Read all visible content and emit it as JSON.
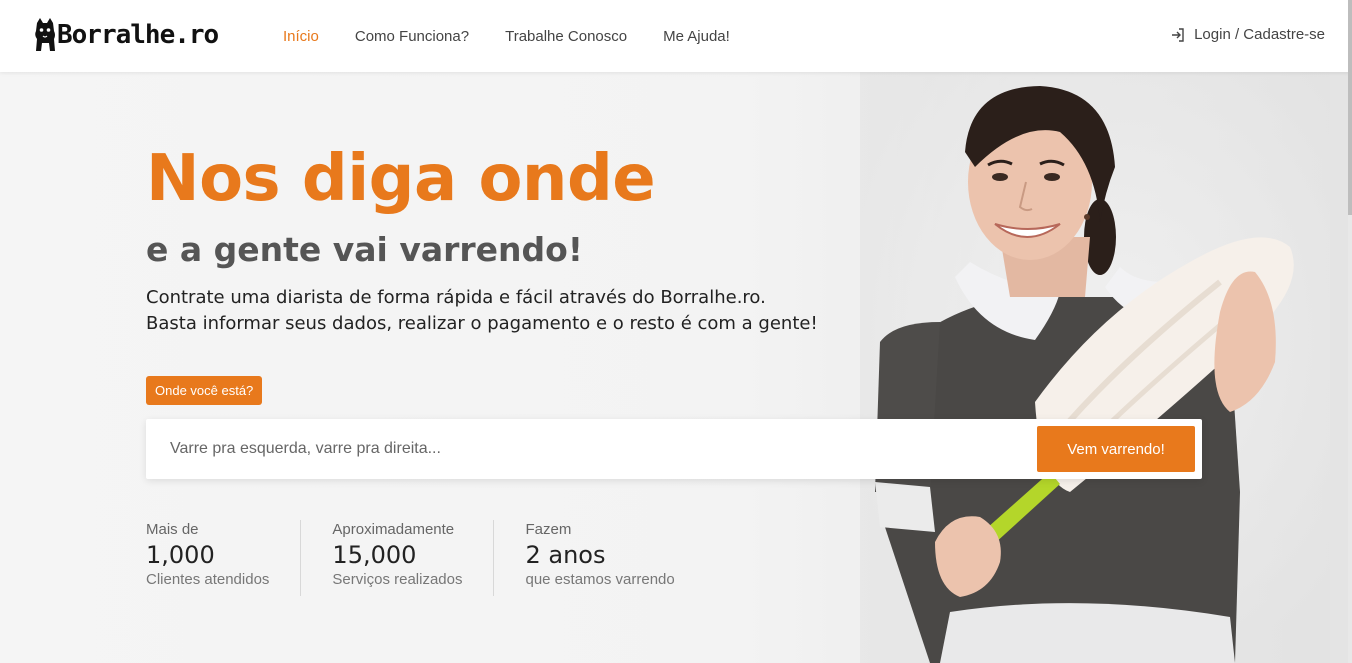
{
  "brand": {
    "logo_text": "Borralhe.ro",
    "accent_color": "#e8791c"
  },
  "nav": {
    "links": [
      {
        "label": "Início",
        "active": true
      },
      {
        "label": "Como Funciona?",
        "active": false
      },
      {
        "label": "Trabalhe Conosco",
        "active": false
      },
      {
        "label": "Me Ajuda!",
        "active": false
      }
    ],
    "login_label": "Login / Cadastre-se",
    "login_icon": "login-icon"
  },
  "hero": {
    "title": "Nos diga onde",
    "subtitle": "e a gente vai varrendo!",
    "description_line1": "Contrate uma diarista de forma rápida e fácil através do Borralhe.ro.",
    "description_line2": "Basta informar seus dados, realizar o pagamento e o resto é com a gente!",
    "location_badge": "Onde você está?",
    "search_placeholder": "Varre pra esquerda, varre pra direita...",
    "search_button": "Vem varrendo!"
  },
  "stats": [
    {
      "pre": "Mais de",
      "value": "1,000",
      "sub": "Clientes atendidos"
    },
    {
      "pre": "Aproximadamente",
      "value": "15,000",
      "sub": "Serviços realizados"
    },
    {
      "pre": "Fazem",
      "value": "2 anos",
      "sub": "que estamos varrendo"
    }
  ]
}
